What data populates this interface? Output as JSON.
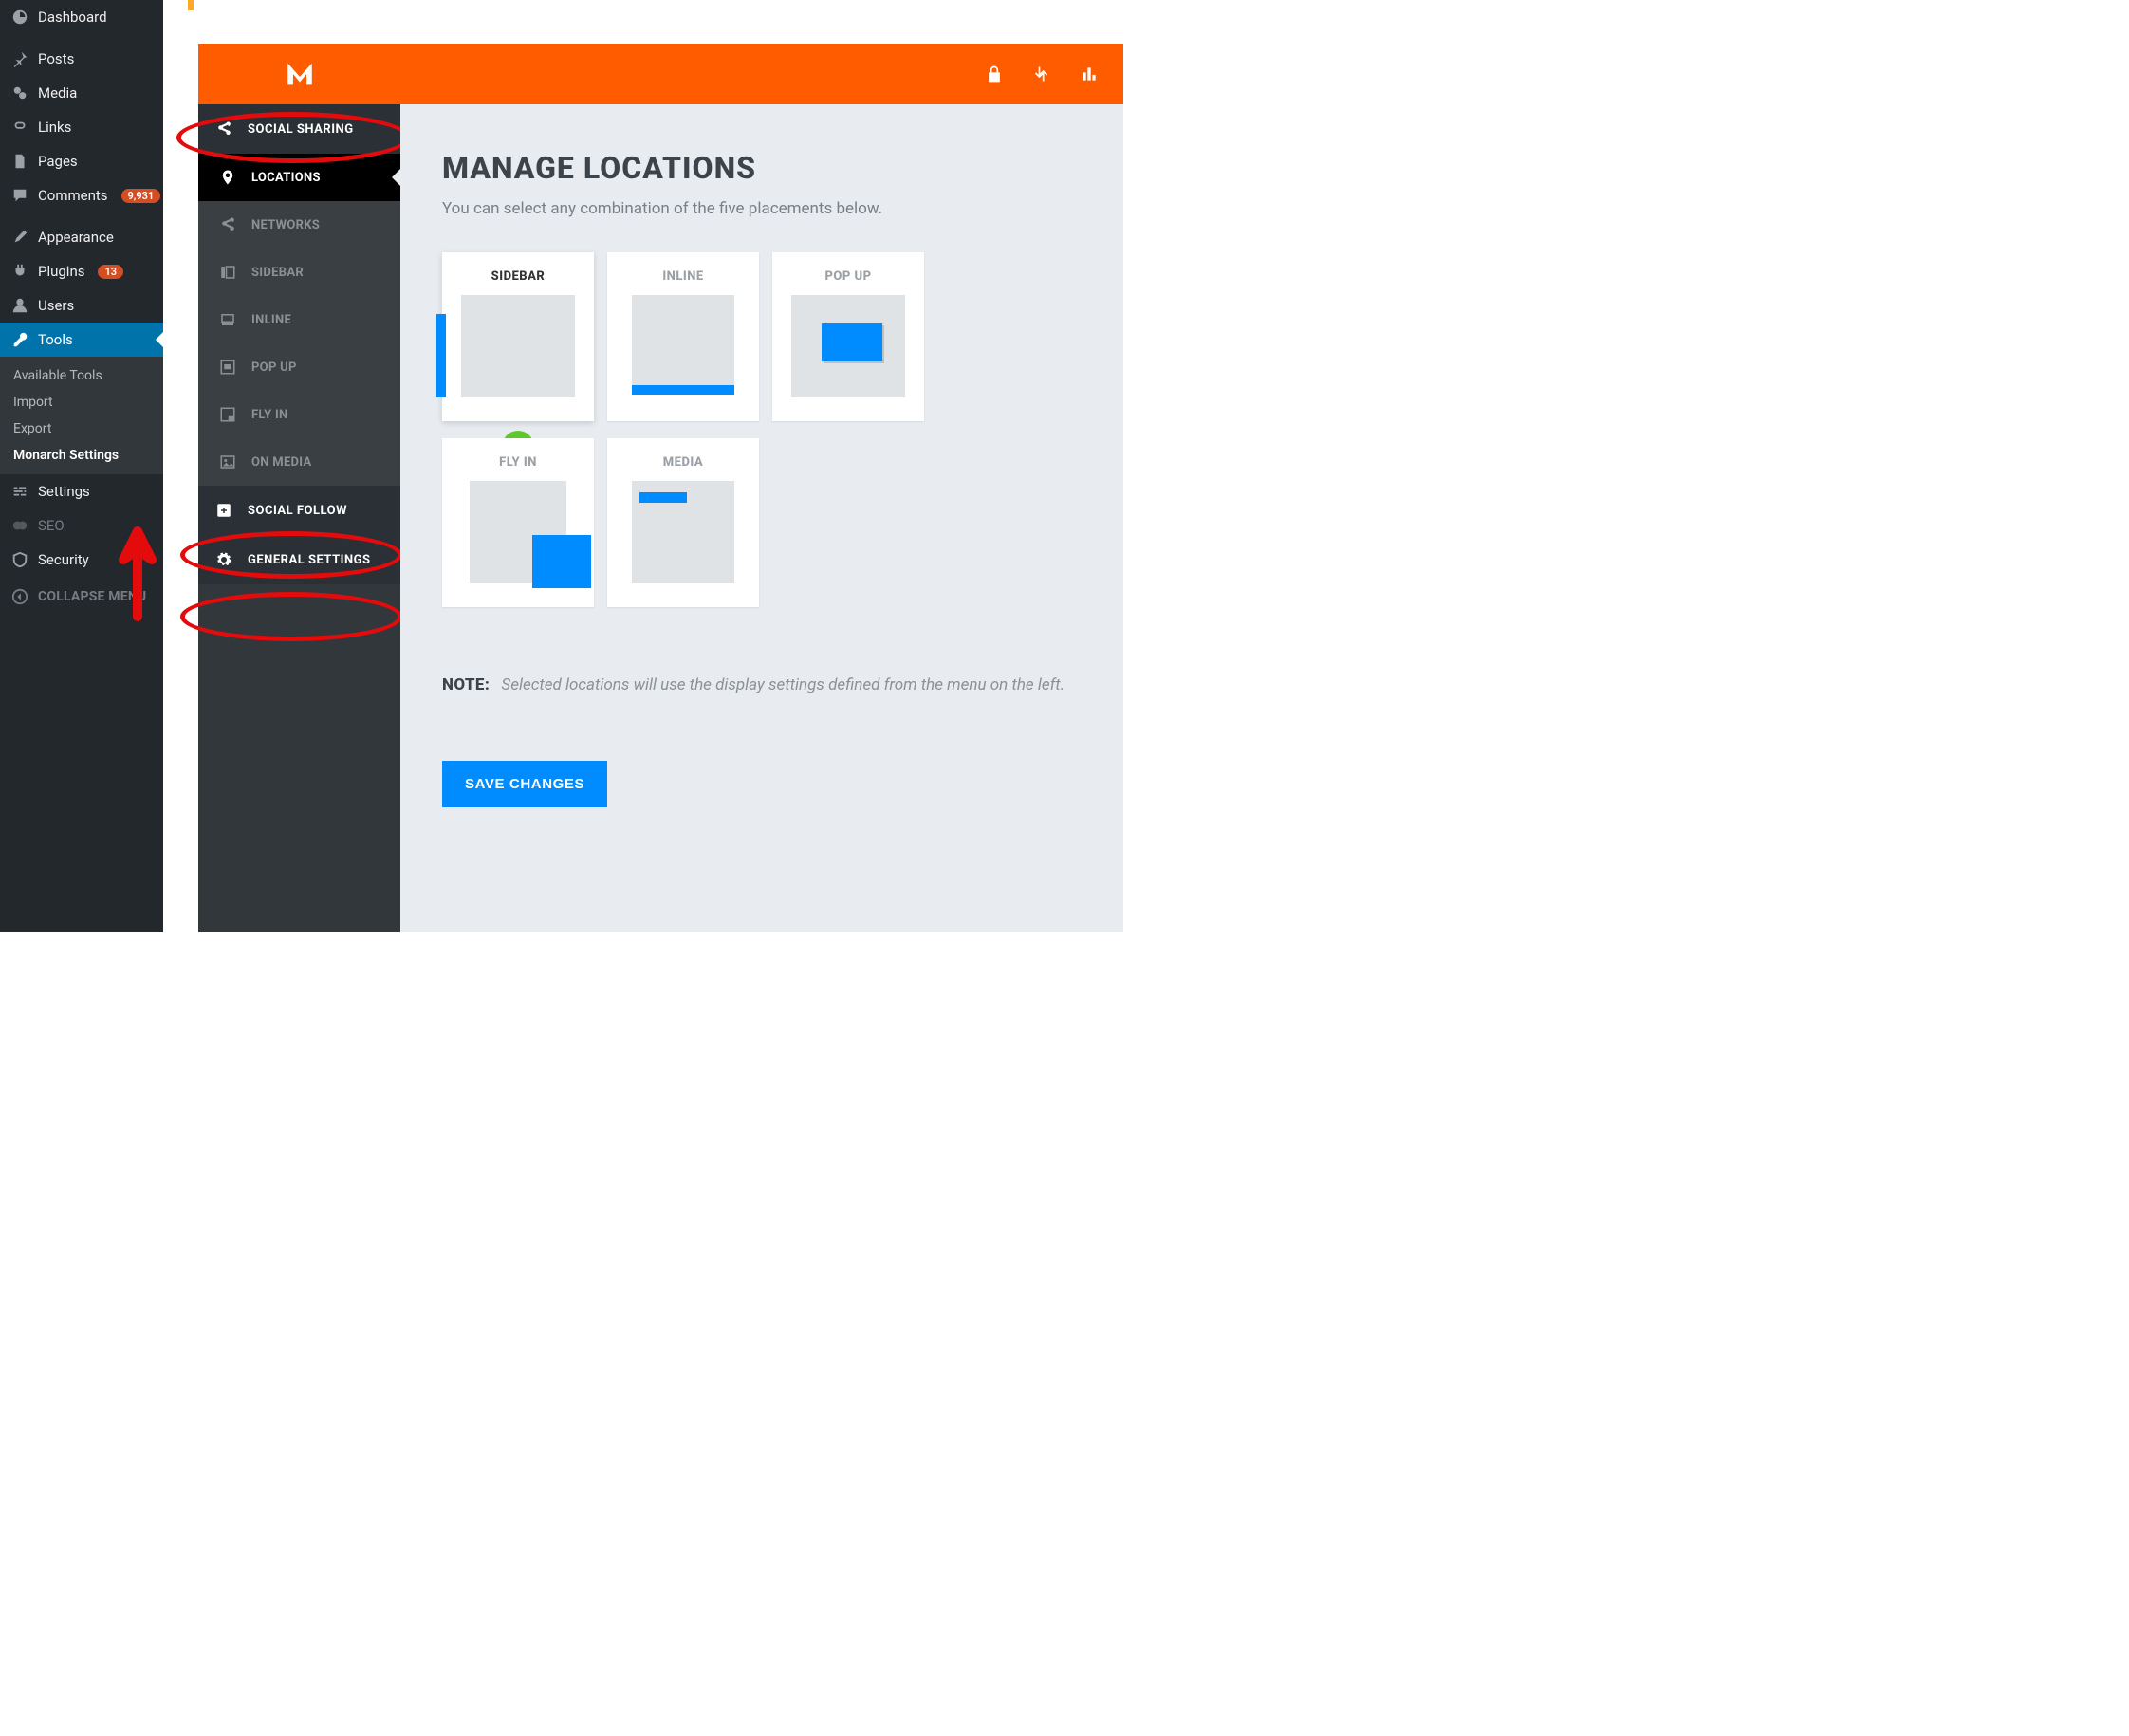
{
  "wp_sidebar": {
    "items": [
      {
        "key": "dashboard",
        "label": "Dashboard"
      },
      {
        "key": "posts",
        "label": "Posts"
      },
      {
        "key": "media",
        "label": "Media"
      },
      {
        "key": "links",
        "label": "Links"
      },
      {
        "key": "pages",
        "label": "Pages"
      },
      {
        "key": "comments",
        "label": "Comments",
        "badge": "9,931"
      },
      {
        "key": "appearance",
        "label": "Appearance"
      },
      {
        "key": "plugins",
        "label": "Plugins",
        "badge": "13"
      },
      {
        "key": "users",
        "label": "Users"
      },
      {
        "key": "tools",
        "label": "Tools",
        "active": true
      },
      {
        "key": "settings",
        "label": "Settings"
      },
      {
        "key": "seo",
        "label": "SEO"
      },
      {
        "key": "security",
        "label": "Security"
      }
    ],
    "tools_sub": [
      {
        "label": "Available Tools"
      },
      {
        "label": "Import"
      },
      {
        "label": "Export"
      },
      {
        "label": "Monarch Settings",
        "current": true
      }
    ],
    "collapse": "COLLAPSE MENU"
  },
  "monarch_sidebar": {
    "sections": [
      {
        "key": "social-sharing",
        "label": "SOCIAL SHARING"
      },
      {
        "key": "social-follow",
        "label": "SOCIAL FOLLOW"
      },
      {
        "key": "general-settings",
        "label": "GENERAL SETTINGS"
      }
    ],
    "sharing_sub": [
      {
        "key": "locations",
        "label": "LOCATIONS",
        "active": true
      },
      {
        "key": "networks",
        "label": "NETWORKS"
      },
      {
        "key": "sidebar",
        "label": "SIDEBAR"
      },
      {
        "key": "inline",
        "label": "INLINE"
      },
      {
        "key": "popup",
        "label": "POP UP"
      },
      {
        "key": "flyin",
        "label": "FLY IN"
      },
      {
        "key": "onmedia",
        "label": "ON MEDIA"
      }
    ]
  },
  "main": {
    "title": "MANAGE LOCATIONS",
    "description": "You can select any combination of the five placements below.",
    "locations": [
      {
        "key": "sidebar",
        "label": "SIDEBAR",
        "selected": true
      },
      {
        "key": "inline",
        "label": "INLINE"
      },
      {
        "key": "popup",
        "label": "POP UP"
      },
      {
        "key": "flyin",
        "label": "FLY IN"
      },
      {
        "key": "media",
        "label": "MEDIA"
      }
    ],
    "note_label": "NOTE:",
    "note_text": "Selected locations will use the display settings defined from the menu on the left.",
    "save": "SAVE CHANGES"
  },
  "colors": {
    "accent": "#ff5c00",
    "blue": "#008cff",
    "wp_active": "#0073aa"
  }
}
